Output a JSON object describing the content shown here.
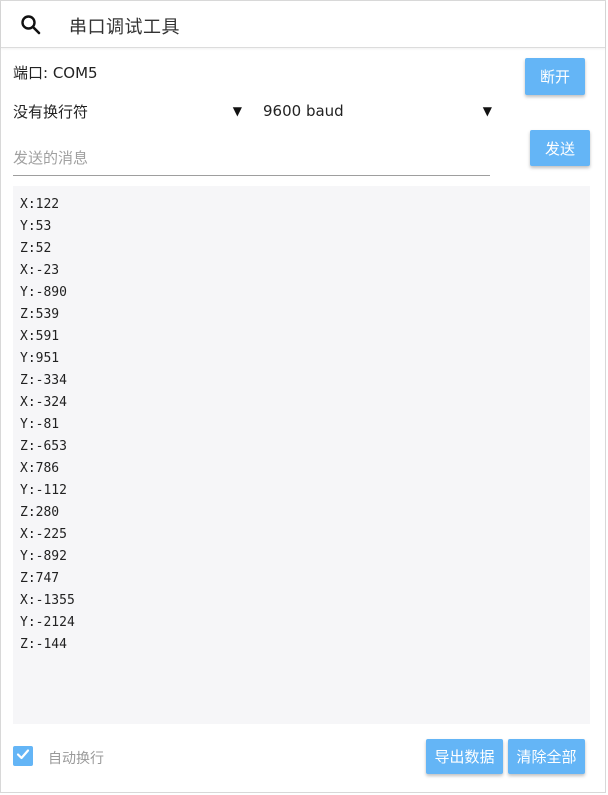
{
  "app": {
    "title": "串口调试工具"
  },
  "connection": {
    "port_label": "端口: COM5",
    "disconnect_label": "断开"
  },
  "settings": {
    "newline_value": "没有换行符",
    "baud_value": "9600 baud"
  },
  "send": {
    "placeholder": "发送的消息",
    "value": "",
    "button_label": "发送"
  },
  "output": {
    "lines": [
      "X:122",
      "Y:53",
      "Z:52",
      "X:-23",
      "Y:-890",
      "Z:539",
      "X:591",
      "Y:951",
      "Z:-334",
      "X:-324",
      "Y:-81",
      "Z:-653",
      "X:786",
      "Y:-112",
      "Z:280",
      "X:-225",
      "Y:-892",
      "Z:747",
      "X:-1355",
      "Y:-2124",
      "Z:-144"
    ]
  },
  "footer": {
    "autowrap_label": "自动换行",
    "autowrap_checked": true,
    "export_label": "导出数据",
    "clear_label": "清除全部"
  },
  "colors": {
    "accent": "#64b5f6",
    "output_bg": "#f6f6f8"
  },
  "icons": {
    "search": "search-icon",
    "dropdown": "triangle-down-icon",
    "check": "check-icon"
  }
}
